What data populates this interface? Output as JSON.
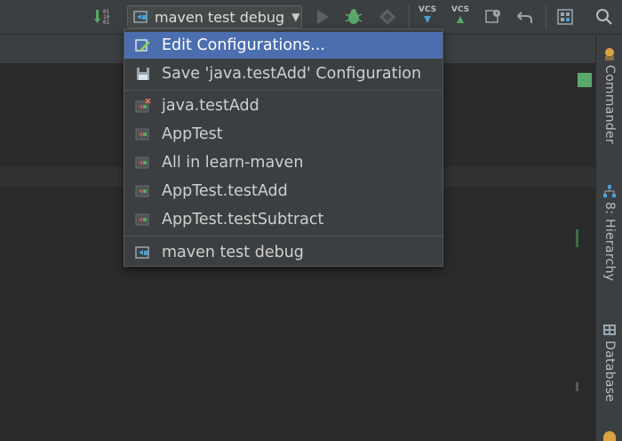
{
  "toolbar": {
    "run_config": "maven test debug",
    "vcs_update": "VCS",
    "vcs_commit": "VCS",
    "bits_top": "01",
    "bits_mid": "10",
    "bits_bot": "01"
  },
  "menu": {
    "items": [
      {
        "label": "Edit Configurations...",
        "icon": "edit-config-icon",
        "selected": true
      },
      {
        "label": "Save 'java.testAdd' Configuration",
        "icon": "save-icon"
      },
      {
        "label": "java.testAdd",
        "icon": "junit-temp-icon"
      },
      {
        "label": "AppTest",
        "icon": "junit-icon"
      },
      {
        "label": "All in learn-maven",
        "icon": "junit-icon"
      },
      {
        "label": "AppTest.testAdd",
        "icon": "junit-icon"
      },
      {
        "label": "AppTest.testSubtract",
        "icon": "junit-icon"
      },
      {
        "label": "maven test debug",
        "icon": "maven-config-icon"
      }
    ]
  },
  "right_strip": {
    "tabs": [
      {
        "label": "Commander",
        "icon": "commander-icon"
      },
      {
        "label": "8: Hierarchy",
        "icon": "hierarchy-icon"
      },
      {
        "label": "Database",
        "icon": "database-icon"
      }
    ]
  },
  "colors": {
    "selection": "#4b6eaf",
    "background": "#2b2b2b",
    "panel": "#3c3f41",
    "run_green": "#499c54",
    "debug_green": "#59a869"
  }
}
